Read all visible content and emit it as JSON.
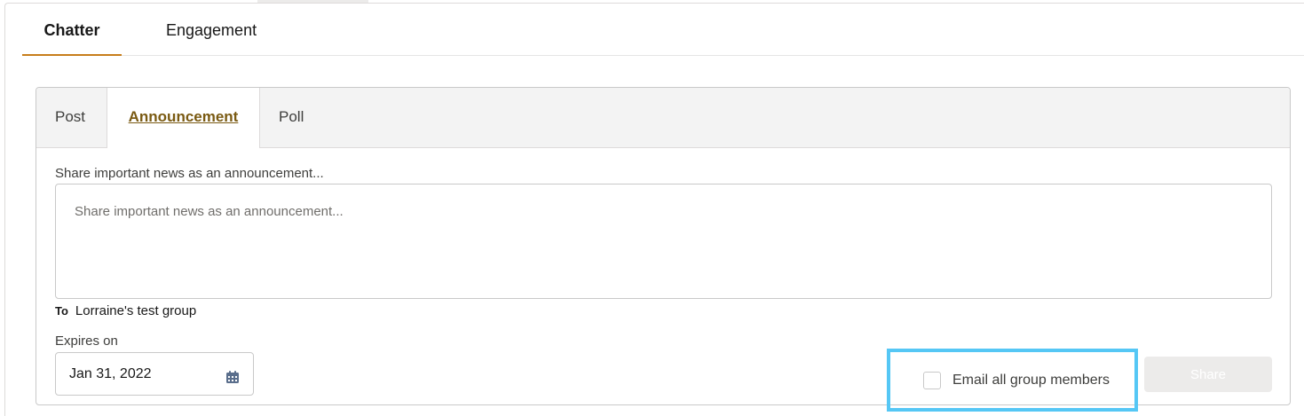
{
  "main_tabs": [
    {
      "label": "Chatter",
      "active": true
    },
    {
      "label": "Engagement",
      "active": false
    }
  ],
  "publisher": {
    "tabs": [
      {
        "label": "Post",
        "active": false
      },
      {
        "label": "Announcement",
        "active": true
      },
      {
        "label": "Poll",
        "active": false
      }
    ],
    "message_label": "Share important news as an announcement...",
    "message_placeholder": "Share important news as an announcement...",
    "message_value": "",
    "to_label": "To",
    "to_value": "Lorraine's test group",
    "expires_label": "Expires on",
    "expires_value": "Jan 31, 2022",
    "email_option_label": "Email all group members",
    "email_option_checked": false,
    "share_button_label": "Share",
    "share_button_enabled": false
  },
  "colors": {
    "active_tab_underline": "#c77d1a",
    "active_subtab_text": "#7a5a12",
    "highlight_border": "#55c7f5",
    "disabled_button": "#ecebea"
  },
  "icons": {
    "date_picker": "calendar-icon"
  }
}
